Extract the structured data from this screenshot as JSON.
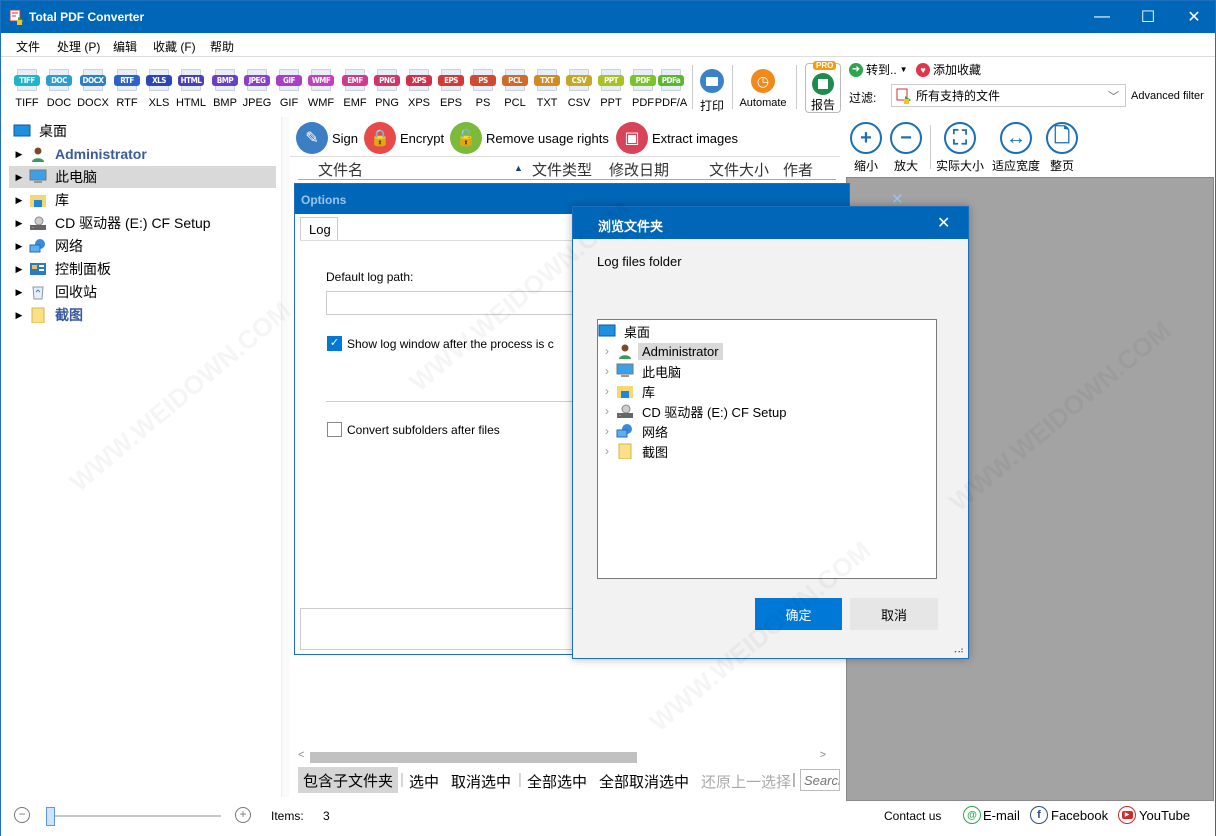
{
  "app": {
    "title": "Total PDF Converter"
  },
  "window_controls": {
    "minimize": "—",
    "maximize": "☐",
    "close": "✕"
  },
  "menu": [
    "文件",
    "处理 (P)",
    "编辑",
    "收藏 (F)",
    "帮助"
  ],
  "formats": [
    {
      "badge": "TIFF",
      "label": "TIFF",
      "color": "#1fb5c6"
    },
    {
      "badge": "DOC",
      "label": "DOC",
      "color": "#2a9ed0"
    },
    {
      "badge": "DOCX",
      "label": "DOCX",
      "color": "#2a7fc9"
    },
    {
      "badge": "RTF",
      "label": "RTF",
      "color": "#2d63c8"
    },
    {
      "badge": "XLS",
      "label": "XLS",
      "color": "#2c45b8"
    },
    {
      "badge": "HTML",
      "label": "HTML",
      "color": "#4a3fb5"
    },
    {
      "badge": "BMP",
      "label": "BMP",
      "color": "#6a3fc0"
    },
    {
      "badge": "JPEG",
      "label": "JPEG",
      "color": "#8a3fc8"
    },
    {
      "badge": "GIF",
      "label": "GIF",
      "color": "#a93fc8"
    },
    {
      "badge": "WMF",
      "label": "WMF",
      "color": "#c43fbc"
    },
    {
      "badge": "EMF",
      "label": "EMF",
      "color": "#d03a8c"
    },
    {
      "badge": "PNG",
      "label": "PNG",
      "color": "#d23466"
    },
    {
      "badge": "XPS",
      "label": "XPS",
      "color": "#d0304a"
    },
    {
      "badge": "EPS",
      "label": "EPS",
      "color": "#d23a38"
    },
    {
      "badge": "PS",
      "label": "PS",
      "color": "#d24a2e"
    },
    {
      "badge": "PCL",
      "label": "PCL",
      "color": "#d06a28"
    },
    {
      "badge": "TXT",
      "label": "TXT",
      "color": "#d08a26"
    },
    {
      "badge": "CSV",
      "label": "CSV",
      "color": "#c6a824"
    },
    {
      "badge": "PPT",
      "label": "PPT",
      "color": "#a8c224"
    },
    {
      "badge": "PDF",
      "label": "PDF",
      "color": "#7cc22a"
    },
    {
      "badge": "PDFa",
      "label": "PDF/A",
      "color": "#5ab82e"
    }
  ],
  "toolbar": {
    "print_label": "打印",
    "automate_label": "Automate",
    "report_label": "报告",
    "pro_badge": "PRO",
    "goto_label": "转到..",
    "add_favorite_label": "添加收藏",
    "filter_label": "过滤:",
    "filter_value": "所有支持的文件",
    "advanced_filter": "Advanced filter"
  },
  "folder_tree": [
    {
      "label": "桌面",
      "icon": "desktop-icon",
      "expandable": false
    },
    {
      "label": "Administrator",
      "icon": "user-icon",
      "expandable": true,
      "style": "bold"
    },
    {
      "label": "此电脑",
      "icon": "computer-icon",
      "expandable": true,
      "selected": true
    },
    {
      "label": "库",
      "icon": "library-icon",
      "expandable": true
    },
    {
      "label": "CD 驱动器 (E:) CF Setup",
      "icon": "cd-drive-icon",
      "expandable": true
    },
    {
      "label": "网络",
      "icon": "network-icon",
      "expandable": true
    },
    {
      "label": "控制面板",
      "icon": "control-panel-icon",
      "expandable": true
    },
    {
      "label": "回收站",
      "icon": "recycle-bin-icon",
      "expandable": true
    },
    {
      "label": "截图",
      "icon": "folder-icon",
      "expandable": true,
      "style": "bold"
    }
  ],
  "actions": [
    {
      "label": "Sign",
      "icon": "sign-icon",
      "color": "#3b7ec4"
    },
    {
      "label": "Encrypt",
      "icon": "lock-icon",
      "color": "#e84a4a"
    },
    {
      "label": "Remove usage rights",
      "icon": "unlock-icon",
      "color": "#7cba3c"
    },
    {
      "label": "Extract images",
      "icon": "image-icon",
      "color": "#d9435a"
    }
  ],
  "columns": [
    "文件名",
    "文件类型",
    "修改日期",
    "文件大小",
    "作者"
  ],
  "selection_bar": {
    "include_subfolders": "包含子文件夹",
    "select": "选中",
    "deselect": "取消选中",
    "select_all": "全部选中",
    "deselect_all": "全部取消选中",
    "restore": "还原上一选择",
    "search_placeholder": "Search"
  },
  "preview_tools": [
    {
      "label": "缩小",
      "icon": "zoom-in-icon",
      "glyph": "+"
    },
    {
      "label": "放大",
      "icon": "zoom-out-icon",
      "glyph": "−"
    },
    {
      "label": "实际大小",
      "icon": "actual-size-icon",
      "glyph": "⛶"
    },
    {
      "label": "适应宽度",
      "icon": "fit-width-icon",
      "glyph": "↔"
    },
    {
      "label": "整页",
      "icon": "full-page-icon",
      "glyph": "🗋"
    }
  ],
  "status": {
    "items_label": "Items:",
    "items_count": "3",
    "thumbnail_zoom": 0,
    "contact": "Contact us",
    "email": "E-mail",
    "facebook": "Facebook",
    "youtube": "YouTube"
  },
  "options_dialog": {
    "title": "Options",
    "tab": "Log",
    "default_log_path_label": "Default log path:",
    "default_log_path_value": "",
    "show_log_label": "Show log window after the process is c",
    "show_log_checked": true,
    "convert_subfolders_label": "Convert subfolders after files",
    "convert_subfolders_checked": false
  },
  "browse_dialog": {
    "title": "浏览文件夹",
    "description": "Log files folder",
    "tree": [
      {
        "label": "桌面",
        "icon": "desktop-icon",
        "root": true
      },
      {
        "label": "Administrator",
        "icon": "user-icon",
        "selected": true
      },
      {
        "label": "此电脑",
        "icon": "computer-icon"
      },
      {
        "label": "库",
        "icon": "library-icon"
      },
      {
        "label": "CD 驱动器 (E:) CF Setup",
        "icon": "cd-drive-icon"
      },
      {
        "label": "网络",
        "icon": "network-icon"
      },
      {
        "label": "截图",
        "icon": "folder-icon"
      }
    ],
    "ok": "确定",
    "cancel": "取消"
  }
}
